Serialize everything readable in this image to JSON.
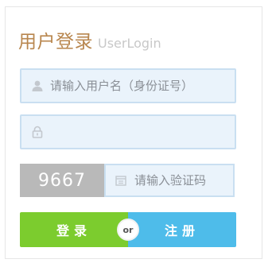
{
  "header": {
    "title_cn": "用户登录",
    "title_en": "UserLogin"
  },
  "username": {
    "placeholder": "请输入用户名（身份证号）",
    "icon": "user-icon"
  },
  "password": {
    "placeholder": "",
    "icon": "lock-icon"
  },
  "captcha": {
    "code": "9667",
    "placeholder": "请输入验证码",
    "icon": "calendar-icon"
  },
  "actions": {
    "login_label": "登录",
    "or_label": "or",
    "register_label": "注册"
  },
  "colors": {
    "title": "#b8864e",
    "field_bg": "#eaf3fb",
    "field_border": "#c9dff1",
    "login": "#7ccc2e",
    "register": "#4ebcea",
    "captcha_bg": "#b9b9b9"
  }
}
